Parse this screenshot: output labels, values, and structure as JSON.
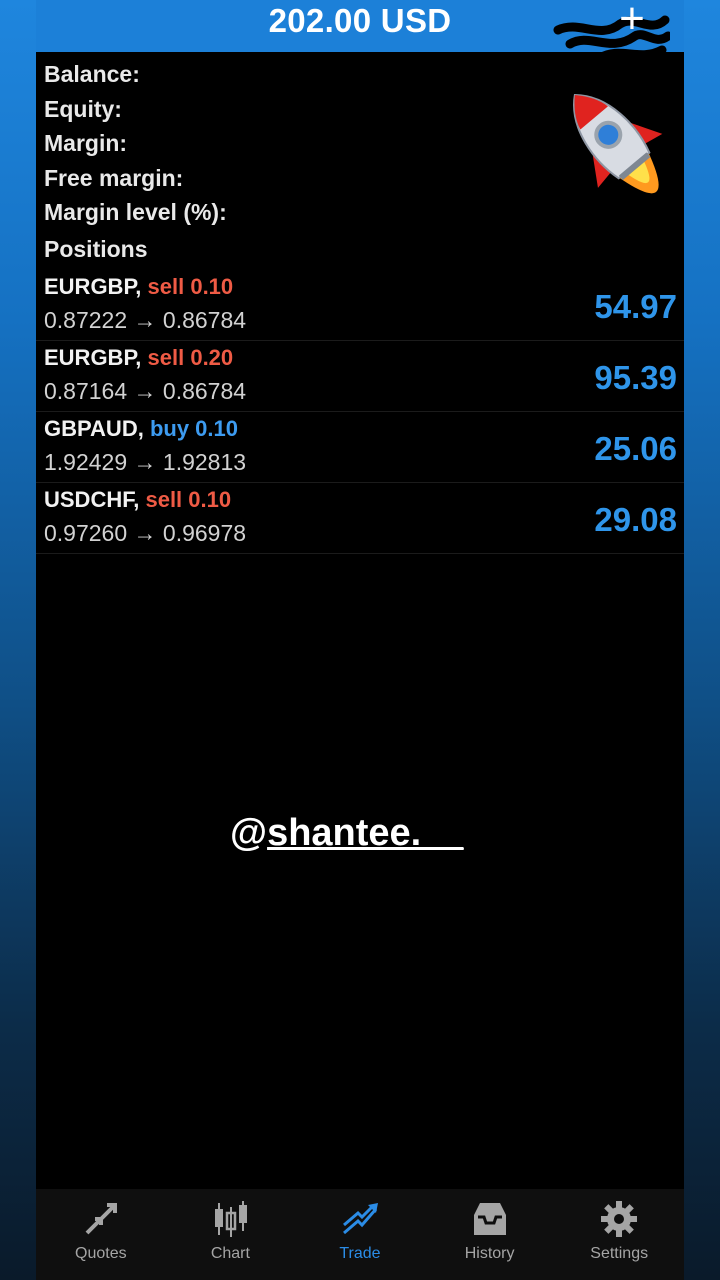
{
  "header": {
    "title": "202.00 USD",
    "add_label": "+"
  },
  "summary": {
    "labels": [
      "Balance:",
      "Equity:",
      "Margin:",
      "Free margin:",
      "Margin level (%):"
    ]
  },
  "positions": {
    "title": "Positions",
    "items": [
      {
        "symbol": "EURGBP,",
        "side": "sell 0.10",
        "side_type": "sell",
        "open": "0.87222",
        "arrow": "→",
        "current": "0.86784",
        "profit": "54.97"
      },
      {
        "symbol": "EURGBP,",
        "side": "sell 0.20",
        "side_type": "sell",
        "open": "0.87164",
        "arrow": "→",
        "current": "0.86784",
        "profit": "95.39"
      },
      {
        "symbol": "GBPAUD,",
        "side": "buy 0.10",
        "side_type": "buy",
        "open": "1.92429",
        "arrow": "→",
        "current": "1.92813",
        "profit": "25.06"
      },
      {
        "symbol": "USDCHF,",
        "side": "sell 0.10",
        "side_type": "sell",
        "open": "0.97260",
        "arrow": "→",
        "current": "0.96978",
        "profit": "29.08"
      }
    ]
  },
  "overlay": {
    "at": "@",
    "handle": "shantee.__"
  },
  "tabbar": {
    "tabs": [
      {
        "label": "Quotes",
        "icon": "quotes-icon"
      },
      {
        "label": "Chart",
        "icon": "chart-icon"
      },
      {
        "label": "Trade",
        "icon": "trade-icon"
      },
      {
        "label": "History",
        "icon": "history-icon"
      },
      {
        "label": "Settings",
        "icon": "settings-icon"
      }
    ],
    "active_index": 2
  },
  "colors": {
    "accent": "#2b8ce6",
    "sell": "#ef5b45",
    "buy": "#3d9bf0",
    "profit": "#2f95ea"
  }
}
